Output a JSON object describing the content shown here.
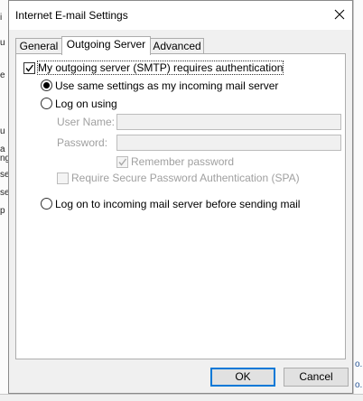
{
  "window": {
    "title": "Internet E-mail Settings"
  },
  "tabs": [
    {
      "label": "General"
    },
    {
      "label": "Outgoing Server"
    },
    {
      "label": "Advanced"
    }
  ],
  "active_tab": "Outgoing Server",
  "outgoing": {
    "requires_auth_label": "My outgoing server (SMTP) requires authentication",
    "requires_auth_checked": true,
    "same_settings_label": "Use same settings as my incoming mail server",
    "logon_using_label": "Log on using",
    "user_name_label": "User Name:",
    "user_name_value": "",
    "password_label": "Password:",
    "password_value": "",
    "remember_password_label": "Remember password",
    "require_spa_label": "Require Secure Password Authentication (SPA)",
    "logon_incoming_first_label": "Log on to incoming mail server before sending mail",
    "selected_option": "Use same settings as my incoming mail server"
  },
  "buttons": {
    "ok": "OK",
    "cancel": "Cancel"
  },
  "background": {
    "left_fragments": [
      "i",
      "u",
      "e",
      "u",
      "a",
      "ng",
      "se",
      "se",
      "p"
    ],
    "right_fragments": [
      "o.",
      "o."
    ]
  },
  "colors": {
    "accent": "#0078d7",
    "dialog_bg": "#f0f0f0",
    "disabled_text": "#a0a0a0"
  }
}
